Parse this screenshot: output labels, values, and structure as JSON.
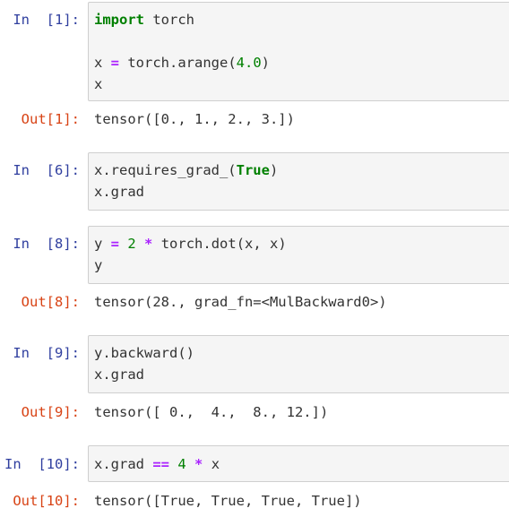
{
  "cells": [
    {
      "in_prompt": "In  [1]:",
      "code": [
        [
          {
            "t": "import",
            "c": "kw"
          },
          {
            "t": " torch",
            "c": "name"
          }
        ],
        [],
        [
          {
            "t": "x ",
            "c": "name"
          },
          {
            "t": "=",
            "c": "op"
          },
          {
            "t": " torch.arange(",
            "c": "name"
          },
          {
            "t": "4.0",
            "c": "num"
          },
          {
            "t": ")",
            "c": "name"
          }
        ],
        [
          {
            "t": "x",
            "c": "name"
          }
        ]
      ],
      "out_prompt": "Out[1]:",
      "output": "tensor([0., 1., 2., 3.])"
    },
    {
      "in_prompt": "In  [6]:",
      "code": [
        [
          {
            "t": "x.requires_grad_(",
            "c": "name"
          },
          {
            "t": "True",
            "c": "lit"
          },
          {
            "t": ")",
            "c": "name"
          }
        ],
        [
          {
            "t": "x.grad",
            "c": "name"
          }
        ]
      ],
      "out_prompt": "",
      "output": ""
    },
    {
      "in_prompt": "In  [8]:",
      "code": [
        [
          {
            "t": "y ",
            "c": "name"
          },
          {
            "t": "=",
            "c": "op"
          },
          {
            "t": " ",
            "c": "name"
          },
          {
            "t": "2",
            "c": "num"
          },
          {
            "t": " ",
            "c": "name"
          },
          {
            "t": "*",
            "c": "op"
          },
          {
            "t": " torch.dot(x, x)",
            "c": "name"
          }
        ],
        [
          {
            "t": "y",
            "c": "name"
          }
        ]
      ],
      "out_prompt": "Out[8]:",
      "output": "tensor(28., grad_fn=<MulBackward0>)"
    },
    {
      "in_prompt": "In  [9]:",
      "code": [
        [
          {
            "t": "y.backward()",
            "c": "name"
          }
        ],
        [
          {
            "t": "x.grad",
            "c": "name"
          }
        ]
      ],
      "out_prompt": "Out[9]:",
      "output": "tensor([ 0.,  4.,  8., 12.])"
    },
    {
      "in_prompt": "In  [10]:",
      "code": [
        [
          {
            "t": "x.grad ",
            "c": "name"
          },
          {
            "t": "==",
            "c": "op"
          },
          {
            "t": " ",
            "c": "name"
          },
          {
            "t": "4",
            "c": "num"
          },
          {
            "t": " ",
            "c": "name"
          },
          {
            "t": "*",
            "c": "op"
          },
          {
            "t": " x",
            "c": "name"
          }
        ]
      ],
      "out_prompt": "Out[10]:",
      "output": "tensor([True, True, True, True])"
    }
  ]
}
